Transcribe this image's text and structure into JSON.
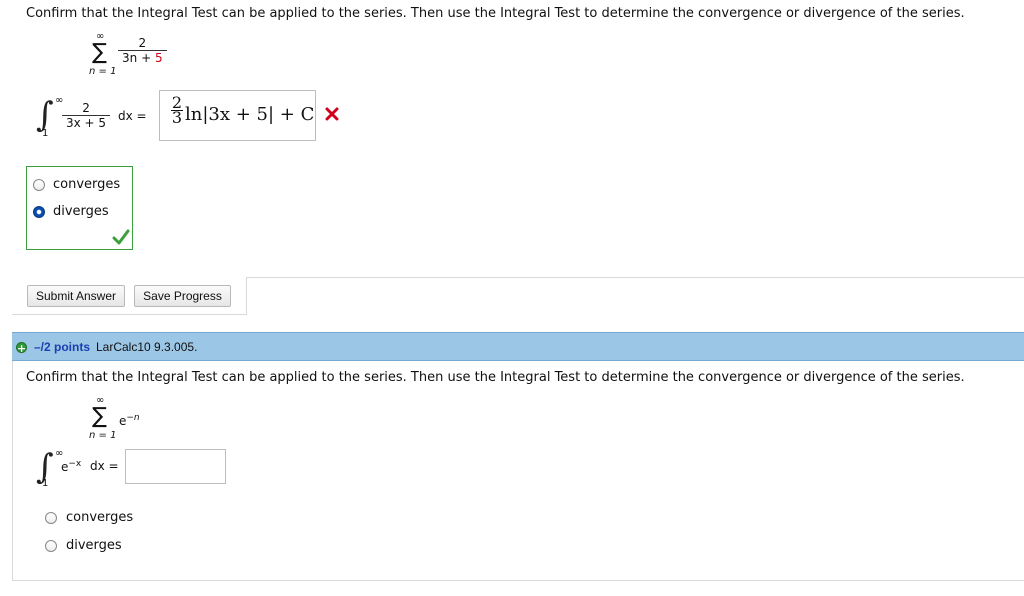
{
  "question1": {
    "prompt": "Confirm that the Integral Test can be applied to the series. Then use the Integral Test to determine the convergence or divergence of the series.",
    "series": {
      "upper": "∞",
      "lower": "n = 1",
      "numerator": "2",
      "denominator_a": "3n",
      "denominator_op": "+",
      "denominator_b": "5"
    },
    "integral": {
      "upper": "∞",
      "lower": "1",
      "numerator": "2",
      "denominator": "3x + 5",
      "dx": "dx ="
    },
    "answer": {
      "coef_num": "2",
      "coef_den": "3",
      "expression": "ln|3x + 5| + C",
      "status_icon": "red-x-icon"
    },
    "options": [
      {
        "label": "converges",
        "selected": false
      },
      {
        "label": "diverges",
        "selected": true
      }
    ],
    "options_status_icon": "green-check-icon",
    "buttons": {
      "submit": "Submit Answer",
      "save": "Save Progress"
    }
  },
  "question2": {
    "header": {
      "points": "–/2 points",
      "code": "LarCalc10 9.3.005."
    },
    "prompt": "Confirm that the Integral Test can be applied to the series. Then use the Integral Test to determine the convergence or divergence of the series.",
    "series": {
      "upper": "∞",
      "lower": "n = 1",
      "term_base": "e",
      "term_exp": "−n"
    },
    "integral": {
      "upper": "∞",
      "lower": "1",
      "base": "e",
      "exp": "−x",
      "dx": "dx ="
    },
    "answer_value": "",
    "options": [
      {
        "label": "converges",
        "selected": false
      },
      {
        "label": "diverges",
        "selected": false
      }
    ]
  },
  "colors": {
    "header_bg": "#9cc6e6",
    "points": "#1a3fb0",
    "correct": "#3aa13a",
    "incorrect": "#d0021b",
    "radio_selected": "#0b4fb3"
  }
}
